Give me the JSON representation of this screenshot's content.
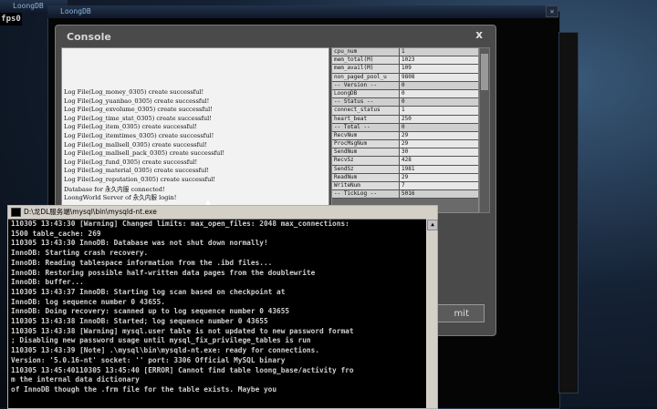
{
  "windows": {
    "back_left_title": "LoongDB",
    "back_center_title": "LoongDB",
    "fps_label": "fps0"
  },
  "console": {
    "title": "Console",
    "close_label": "x",
    "log_lines": [
      "Log File(Log_money_0305) create successful!",
      "Log File(Log_yuanbao_0305) create successful!",
      "Log File(Log_exvolume_0305) create successful!",
      "Log File(Log_time_stat_0305) create successful!",
      "Log File(Log_item_0305) create successful!",
      "Log File(Log_itemtimes_0305) create successful!",
      "Log File(Log_mallsell_0305) create successful!",
      "Log File(Log_mallsell_pack_0305) create successful!",
      "Log File(Log_fund_0305) create successful!",
      "Log File(Log_material_0305) create successful!",
      "Log File(Log_reputation_0305) create successful!"
    ],
    "db_lines": [
      "Database for 永久内服 connected!",
      "LoongWorld Server of 永久内服 login!"
    ],
    "stats": [
      {
        "key": "cpu_num",
        "value": "1",
        "sep": true
      },
      {
        "key": "mem_total(M)",
        "value": "1023"
      },
      {
        "key": "mem_avail(M)",
        "value": "109"
      },
      {
        "key": "non_paged_pool_u",
        "value": "9808"
      },
      {
        "key": "-- Version --",
        "value": "0",
        "sep": true
      },
      {
        "key": "LoongDB",
        "value": "0"
      },
      {
        "key": "-- Status --",
        "value": "0",
        "sep": true
      },
      {
        "key": "connect_status",
        "value": "1"
      },
      {
        "key": "heart_beat",
        "value": "250"
      },
      {
        "key": "-- Total --",
        "value": "0",
        "sep": true
      },
      {
        "key": "RecvNum",
        "value": "29"
      },
      {
        "key": "ProcMsgNum",
        "value": "29"
      },
      {
        "key": "SendNum",
        "value": "30"
      },
      {
        "key": "RecvSz",
        "value": "428"
      },
      {
        "key": "SendSz",
        "value": "1981"
      },
      {
        "key": "ReadNum",
        "value": "29"
      },
      {
        "key": "WriteNum",
        "value": "7"
      },
      {
        "key": "-- TickLog --",
        "value": "5016",
        "sep": true
      }
    ],
    "submit_label": "mit"
  },
  "cmd": {
    "title": "D:\\龙DL服务端\\mysql\\bin\\mysqld-nt.exe",
    "lines": [
      "110305 13:43:30 [Warning] Changed limits: max_open_files: 2048  max_connections:",
      " 1500  table_cache: 269",
      "110305 13:43:30  InnoDB: Database was not shut down normally!",
      "InnoDB: Starting crash recovery.",
      "InnoDB: Reading tablespace information from the .ibd files...",
      "InnoDB: Restoring possible half-written data pages from the doublewrite",
      "InnoDB: buffer...",
      "110305 13:43:37  InnoDB: Starting log scan based on checkpoint at",
      "InnoDB: log sequence number 0 43655.",
      "InnoDB: Doing recovery: scanned up to log sequence number 0 43655",
      "110305 13:43:38  InnoDB: Started; log sequence number 0 43655",
      "110305 13:43:38 [Warning] mysql.user table is not updated to new password format",
      "; Disabling new password usage until mysql_fix_privilege_tables is run",
      "110305 13:43:39 [Note] .\\mysql\\bin\\mysqld-nt.exe: ready for connections.",
      "Version: '5.0.16-nt'  socket: ''  port: 3306  Official MySQL binary",
      "110305 13:45:40110305 13:45:40 [ERROR] Cannot find table loong_base/activity fro",
      "m the internal data dictionary",
      "of InnoDB though the .frm file for the table exists. Maybe you"
    ]
  }
}
